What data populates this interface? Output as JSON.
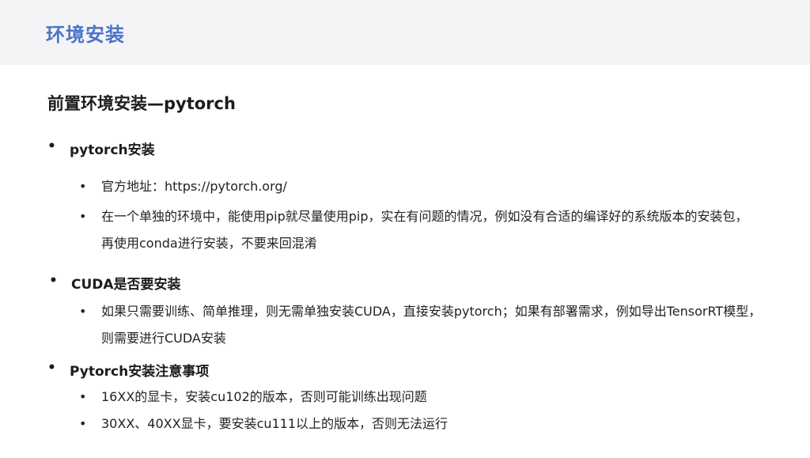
{
  "header": {
    "title": "环境安装"
  },
  "section_title": "前置环境安装—pytorch",
  "groups": [
    {
      "heading": "pytorch安装",
      "items": [
        "官方地址：https://pytorch.org/",
        "在一个单独的环境中，能使用pip就尽量使用pip，实在有问题的情况，例如没有合适的编译好的系统版本的安装包，再使用conda进行安装，不要来回混淆"
      ]
    },
    {
      "heading": "CUDA是否要安装",
      "items": [
        "如果只需要训练、简单推理，则无需单独安装CUDA，直接安装pytorch；如果有部署需求，例如导出TensorRT模型，则需要进行CUDA安装"
      ]
    },
    {
      "heading": "Pytorch安装注意事项",
      "items": [
        "16XX的显卡，安装cu102的版本，否则可能训练出现问题",
        "30XX、40XX显卡，要安装cu111以上的版本，否则无法运行"
      ]
    }
  ]
}
